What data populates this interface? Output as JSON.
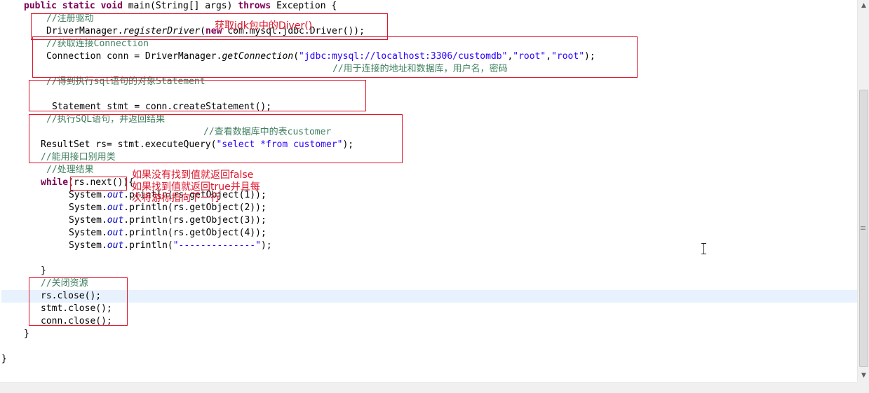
{
  "code": {
    "l1": {
      "kw1": "public",
      "kw2": "static",
      "kw3": "void",
      "p1": " main(String[] args) ",
      "kw4": "throws",
      "p2": " Exception {"
    },
    "l2": "//注册驱动",
    "l3": {
      "a": "DriverManager.",
      "b": "registerDriver",
      "c": "(",
      "kw": "new",
      "d": " com.mysql.jdbc.Driver());"
    },
    "l4": "//获取连接Connection",
    "l5": {
      "a": "Connection conn = DriverManager.",
      "b": "getConnection",
      "c": "(",
      "s1": "\"jdbc:mysql://localhost:3306/customdb\"",
      "c1": ",",
      "s2": "\"root\"",
      "c2": ",",
      "s3": "\"root\"",
      "d": ");"
    },
    "l6": "//用于连接的地址和数据库，用户名，密码",
    "l7": "//得到执行sql语句的对象Statement",
    "l8": "Statement stmt = conn.createStatement();",
    "l9": "//执行SQL语句，并返回结果",
    "l10": "//查看数据库中的表customer",
    "l11": {
      "a": "ResultSet rs= stmt.executeQuery(",
      "s": "\"select *from customer\"",
      "b": ");"
    },
    "l12": "//能用接口别用类",
    "l13": "//处理结果",
    "l14": {
      "kw": "while",
      "a": "(rs.next()){"
    },
    "l15": {
      "a": "System.",
      "f": "out",
      "b": ".println(rs.getObject(1));"
    },
    "l16": {
      "a": "System.",
      "f": "out",
      "b": ".println(rs.getObject(2));"
    },
    "l17": {
      "a": "System.",
      "f": "out",
      "b": ".println(rs.getObject(3));"
    },
    "l18": {
      "a": "System.",
      "f": "out",
      "b": ".println(rs.getObject(4));"
    },
    "l19": {
      "a": "System.",
      "f": "out",
      "b": ".println(",
      "s": "\"--------------\"",
      "c": ");"
    },
    "l20": "}",
    "l21": "//关闭资源",
    "l22": "rs.close();",
    "l23": "stmt.close();",
    "l24": "conn.close();",
    "l25": "}",
    "l26": "}"
  },
  "annotations": {
    "diver": "获取jdk包中的Diver()",
    "next_line1": "如果没有找到值就返回false",
    "next_line2": "如果找到值就返回true并且每",
    "next_line3": "次将游标指向下一行"
  },
  "colors": {
    "keyword": "#7f0055",
    "comment": "#3f7f5f",
    "string": "#2a00ff",
    "field": "#0000c0",
    "annotation": "#e0142a",
    "current_line": "#e8f2fe"
  },
  "icons": {
    "scroll_up": "triangle-up",
    "scroll_down": "triangle-down",
    "cursor": "ibeam-cursor"
  }
}
